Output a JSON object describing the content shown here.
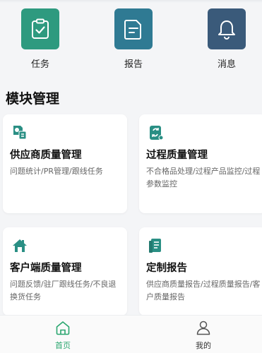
{
  "quick_actions": [
    {
      "label": "任务",
      "icon": "clipboard-check-icon",
      "color": "#2e9a7f"
    },
    {
      "label": "报告",
      "icon": "document-icon",
      "color": "#2f7a93"
    },
    {
      "label": "消息",
      "icon": "bell-icon",
      "color": "#3a5a7a"
    }
  ],
  "section_title": "模块管理",
  "modules": [
    {
      "title": "供应商质量管理",
      "desc": "问题统计/PR管理/跟线任务",
      "icon": "supplier-quality-icon"
    },
    {
      "title": "过程质量管理",
      "desc": "不合格品处理/过程产品监控/过程参数监控",
      "icon": "process-quality-icon"
    },
    {
      "title": "客户端质量管理",
      "desc": "问题反馈/驻厂跟线任务/不良退换货任务",
      "icon": "customer-house-icon"
    },
    {
      "title": "定制报告",
      "desc": "供应商质量报告/过程质量报告/客户质量报告",
      "icon": "custom-report-icon"
    }
  ],
  "tabbar": [
    {
      "label": "首页",
      "icon": "home-icon",
      "active": true
    },
    {
      "label": "我的",
      "icon": "user-icon",
      "active": false
    }
  ],
  "colors": {
    "accent": "#2aa66f",
    "module_icon": "#2a8f84"
  }
}
